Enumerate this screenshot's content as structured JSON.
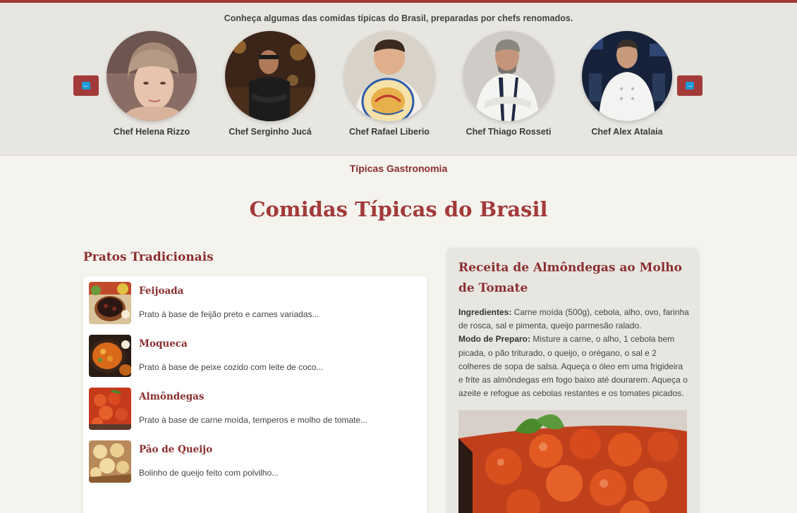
{
  "chef_band": {
    "intro": "Conheça algumas das comidas típicas do Brasil, preparadas por chefs renomados.",
    "prev_icon": "arrow-left-icon",
    "next_icon": "arrow-right-icon",
    "arrow_color": "#1e9ad6",
    "chefs": [
      {
        "name": "Chef Helena Rizzo"
      },
      {
        "name": "Chef Serginho Jucá"
      },
      {
        "name": "Chef Rafael Liberio"
      },
      {
        "name": "Chef Thiago Rosseti"
      },
      {
        "name": "Chef Alex Atalaia"
      }
    ]
  },
  "brand": "Típicas Gastronomia",
  "page_title": "Comidas Típicas do Brasil",
  "dishes_section": {
    "title": "Pratos Tradicionais",
    "items": [
      {
        "name": "Feijoada",
        "description": "Prato à base de feijão preto e carnes variadas..."
      },
      {
        "name": "Moqueca",
        "description": "Prato à base de peixe cozido com leite de coco..."
      },
      {
        "name": "Almôndegas",
        "description": "Prato à base de carne moída, temperos e molho de tomate..."
      },
      {
        "name": "Pão de Queijo",
        "description": "Bolinho de queijo feito com polvilho..."
      }
    ]
  },
  "recipe": {
    "title": "Receita de Almôndegas ao Molho de Tomate",
    "ingredients_label": "Ingredientes:",
    "ingredients": " Carne moída (500g), cebola, alho, ovo, farinha de rosca, sal e pimenta, queijo parmesão ralado.",
    "method_label": "Modo de Preparo:",
    "method": " Misture a carne, o alho, 1 cebola bem picada, o pão triturado, o queijo, o orégano, o sal e 2 colheres de sopa de salsa. Aqueça o óleo em uma frigideira e frite as almôndegas em fogo baixo até dourarem. Aqueça o azeite e refogue as cebolas restantes e os tomates picados."
  },
  "colors": {
    "accent": "#a33a3a",
    "heading": "#8b2e2e",
    "band_background": "#e8e6e1",
    "page_background": "#f4f3ee"
  }
}
